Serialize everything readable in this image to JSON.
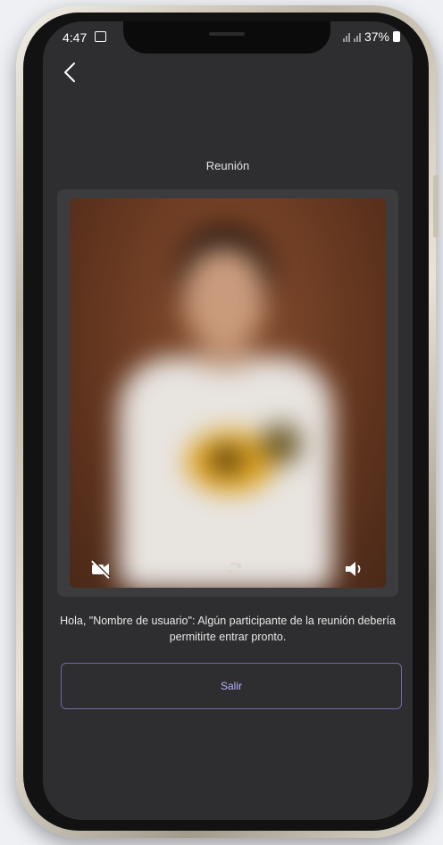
{
  "status_bar": {
    "time": "4:47",
    "battery": "37%"
  },
  "header": {
    "back_icon": "chevron-left-icon",
    "title": "Reunión"
  },
  "video_preview": {
    "controls": [
      {
        "name": "camera-off",
        "icon": "video-off-icon"
      },
      {
        "name": "switch-camera",
        "icon": "camera-rotate-icon"
      },
      {
        "name": "speaker",
        "icon": "speaker-icon"
      }
    ]
  },
  "waiting_message": "Hola, \"Nombre de usuario\": Algún participante de la reunión debería permitirte entrar pronto.",
  "actions": {
    "leave_label": "Salir"
  },
  "colors": {
    "screen_bg": "#2e2e30",
    "card_bg": "#3c3c3e",
    "accent": "#6e6aa8",
    "accent_text": "#b7b2ff"
  }
}
